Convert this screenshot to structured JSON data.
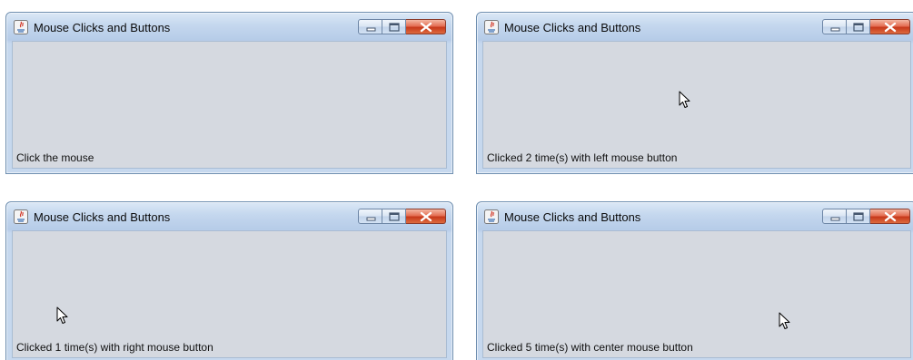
{
  "windows": [
    {
      "title": "Mouse Clicks and Buttons",
      "status_text": "Click the mouse",
      "icons": {
        "app": "java-app-icon",
        "minimize": "minimize-icon",
        "maximize": "maximize-icon",
        "close": "close-icon"
      }
    },
    {
      "title": "Mouse Clicks and Buttons",
      "status_text": "Clicked 2 time(s) with left mouse button",
      "icons": {
        "app": "java-app-icon",
        "minimize": "minimize-icon",
        "maximize": "maximize-icon",
        "close": "close-icon",
        "cursor": "mouse-pointer-icon"
      }
    },
    {
      "title": "Mouse Clicks and Buttons",
      "status_text": "Clicked 1 time(s) with right mouse button",
      "icons": {
        "app": "java-app-icon",
        "minimize": "minimize-icon",
        "maximize": "maximize-icon",
        "close": "close-icon",
        "cursor": "mouse-pointer-icon"
      }
    },
    {
      "title": "Mouse Clicks and Buttons",
      "status_text": "Clicked 5 time(s) with center mouse button",
      "icons": {
        "app": "java-app-icon",
        "minimize": "minimize-icon",
        "maximize": "maximize-icon",
        "close": "close-icon",
        "cursor": "mouse-pointer-icon"
      }
    }
  ],
  "colors": {
    "client_background": "#d5d9e0",
    "close_button": "#c7391b",
    "title_bar": "#c4d7ee"
  }
}
